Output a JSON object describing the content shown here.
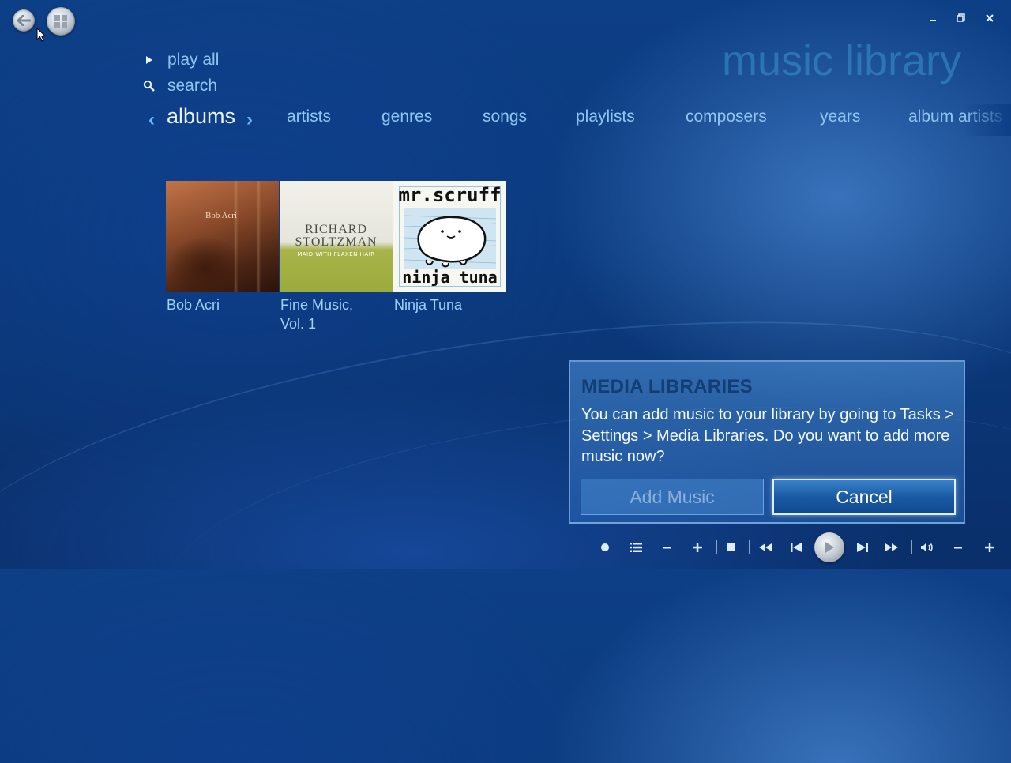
{
  "app": {
    "title": "music library"
  },
  "menu": {
    "play_all": "play all",
    "search": "search"
  },
  "pivot": {
    "active": "albums",
    "tabs": [
      "artists",
      "genres",
      "songs",
      "playlists",
      "composers",
      "years",
      "album artists"
    ]
  },
  "albums": [
    {
      "title": "Bob Acri",
      "cover_text": "Bob Acri"
    },
    {
      "title": "Fine Music, Vol. 1",
      "title_line1": "Fine Music,",
      "title_line2": "Vol. 1",
      "cover_line1": "RICHARD",
      "cover_line2": "STOLTZMAN",
      "cover_line3": "MAID WITH FLAXEN HAIR"
    },
    {
      "title": "Ninja Tuna",
      "cover_top": "mr.scruff",
      "cover_bottom": "ninja tuna"
    }
  ],
  "dialog": {
    "title": "MEDIA LIBRARIES",
    "message": "You can add music to your library by going to Tasks > Settings > Media Libraries. Do you want to add more music now?",
    "add_button": "Add Music",
    "cancel_button": "Cancel"
  },
  "icons": {
    "back": "back-arrow-icon",
    "start": "windows-logo-icon",
    "minimize": "minimize-icon",
    "restore": "restore-icon",
    "close": "close-icon"
  },
  "colors": {
    "background": "#0b3a7e",
    "accent": "#8fc6f0",
    "dialog_title": "#123d75"
  }
}
